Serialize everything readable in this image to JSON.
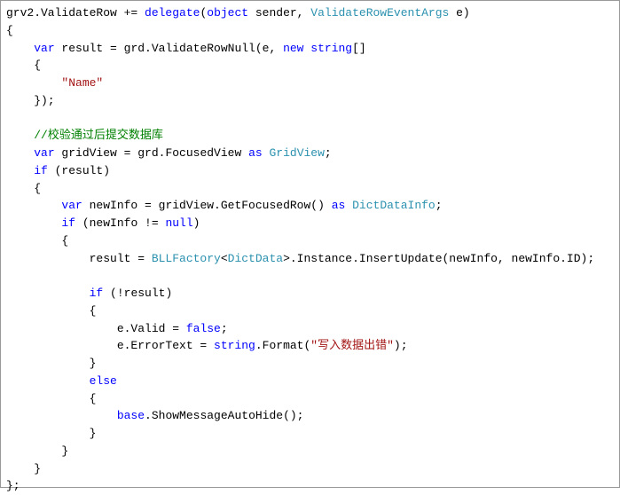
{
  "code": {
    "l1_p1": "grv2.ValidateRow += ",
    "l1_kw1": "delegate",
    "l1_p2": "(",
    "l1_kw2": "object",
    "l1_p3": " sender, ",
    "l1_type1": "ValidateRowEventArgs",
    "l1_p4": " e)",
    "l2": "{",
    "l3_p1": "    ",
    "l3_kw1": "var",
    "l3_p2": " result = grd.ValidateRowNull(e, ",
    "l3_kw2": "new",
    "l3_p3": " ",
    "l3_kw3": "string",
    "l3_p4": "[]",
    "l4": "    {",
    "l5_p1": "        ",
    "l5_str": "\"Name\"",
    "l6": "    });",
    "l7": "",
    "l8_p1": "    ",
    "l8_comment": "//校验通过后提交数据库",
    "l9_p1": "    ",
    "l9_kw1": "var",
    "l9_p2": " gridView = grd.FocusedView ",
    "l9_kw2": "as",
    "l9_p3": " ",
    "l9_type1": "GridView",
    "l9_p4": ";",
    "l10_p1": "    ",
    "l10_kw1": "if",
    "l10_p2": " (result)",
    "l11": "    {",
    "l12_p1": "        ",
    "l12_kw1": "var",
    "l12_p2": " newInfo = gridView.GetFocusedRow() ",
    "l12_kw2": "as",
    "l12_p3": " ",
    "l12_type1": "DictDataInfo",
    "l12_p4": ";",
    "l13_p1": "        ",
    "l13_kw1": "if",
    "l13_p2": " (newInfo != ",
    "l13_kw2": "null",
    "l13_p3": ")",
    "l14": "        {",
    "l15_p1": "            result = ",
    "l15_type1": "BLLFactory",
    "l15_p2": "<",
    "l15_type2": "DictData",
    "l15_p3": ">.Instance.InsertUpdate(newInfo, newInfo.ID);",
    "l16": "",
    "l17_p1": "            ",
    "l17_kw1": "if",
    "l17_p2": " (!result)",
    "l18": "            {",
    "l19_p1": "                e.Valid = ",
    "l19_kw1": "false",
    "l19_p2": ";",
    "l20_p1": "                e.ErrorText = ",
    "l20_kw1": "string",
    "l20_p2": ".Format(",
    "l20_str": "\"写入数据出错\"",
    "l20_p3": ");",
    "l21": "            }",
    "l22_p1": "            ",
    "l22_kw1": "else",
    "l23": "            {",
    "l24_p1": "                ",
    "l24_kw1": "base",
    "l24_p2": ".ShowMessageAutoHide();",
    "l25": "            }",
    "l26": "        }",
    "l27": "    }",
    "l28": "};"
  }
}
